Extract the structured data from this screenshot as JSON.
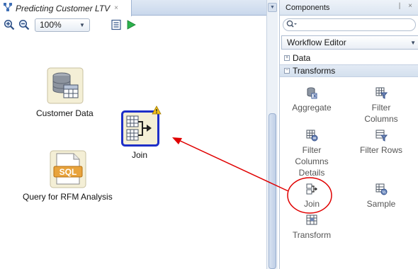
{
  "editor": {
    "tab_title": "Predicting Customer LTV",
    "tab_close": "×",
    "zoom_value": "100%"
  },
  "canvas": {
    "nodes": [
      {
        "label": "Customer Data",
        "icon": "database-table-icon"
      },
      {
        "label": "Join",
        "icon": "join-icon",
        "warning": true
      },
      {
        "label": "Query for RFM Analysis",
        "icon": "sql-query-icon"
      }
    ]
  },
  "components": {
    "title": "Components",
    "header_buttons": "| ×",
    "search_placeholder": "",
    "palette": "Workflow Editor",
    "sections": [
      {
        "label": "Data",
        "expanded": false
      },
      {
        "label": "Transforms",
        "expanded": true
      }
    ],
    "items": [
      {
        "label": "Aggregate",
        "icon": "aggregate-icon"
      },
      {
        "label": "Filter Columns",
        "icon": "filter-columns-icon"
      },
      {
        "label": "Filter Columns Details",
        "icon": "filter-columns-details-icon"
      },
      {
        "label": "Filter Rows",
        "icon": "filter-rows-icon"
      },
      {
        "label": "Join",
        "icon": "join-icon"
      },
      {
        "label": "Sample",
        "icon": "sample-icon"
      },
      {
        "label": "Transform",
        "icon": "transform-icon"
      }
    ]
  },
  "colors": {
    "selection_border": "#1e2fc8",
    "annotation_red": "#e00000",
    "warning_yellow": "#f3c21b"
  }
}
